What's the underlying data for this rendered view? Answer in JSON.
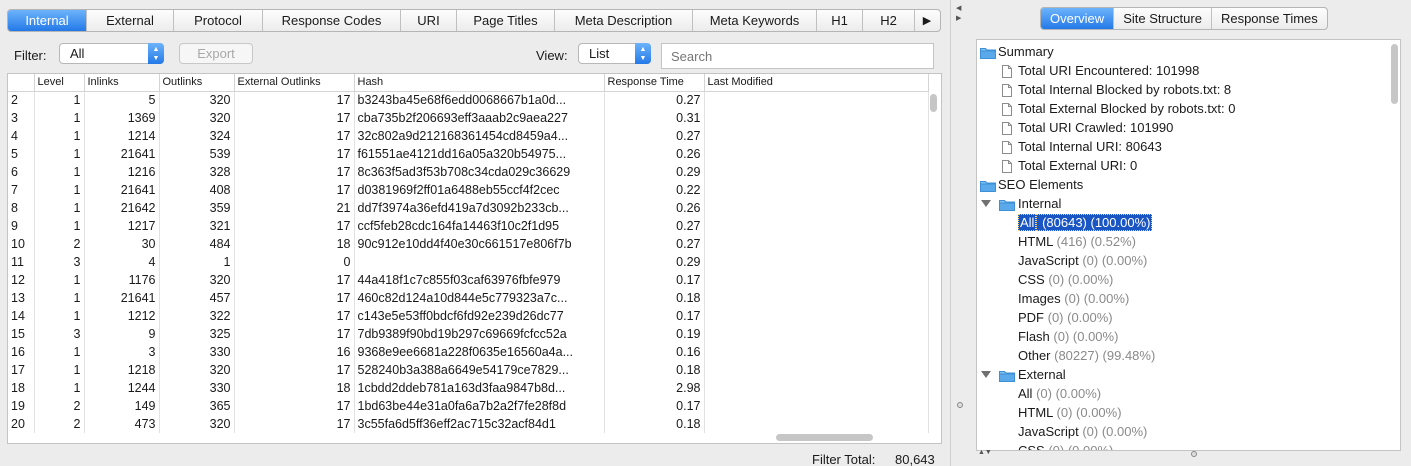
{
  "tabs": [
    "Internal",
    "External",
    "Protocol",
    "Response Codes",
    "URI",
    "Page Titles",
    "Meta Description",
    "Meta Keywords",
    "H1",
    "H2"
  ],
  "toolbar": {
    "filter_label": "Filter:",
    "filter_value": "All",
    "export_label": "Export",
    "view_label": "View:",
    "view_value": "List",
    "search_placeholder": "Search"
  },
  "table": {
    "columns": [
      "",
      "Level",
      "Inlinks",
      "Outlinks",
      "External Outlinks",
      "Hash",
      "Response Time",
      "Last Modified"
    ],
    "rows": [
      [
        "2",
        "1",
        "5",
        "320",
        "17",
        "b3243ba45e68f6edd0068667b1a0d...",
        "0.27",
        ""
      ],
      [
        "3",
        "1",
        "1369",
        "320",
        "17",
        "cba735b2f206693eff3aaab2c9aea227",
        "0.31",
        ""
      ],
      [
        "4",
        "1",
        "1214",
        "324",
        "17",
        "32c802a9d212168361454cd8459a4...",
        "0.27",
        ""
      ],
      [
        "5",
        "1",
        "21641",
        "539",
        "17",
        "f61551ae4121dd16a05a320b54975...",
        "0.26",
        ""
      ],
      [
        "6",
        "1",
        "1216",
        "328",
        "17",
        "8c363f5ad3f53b708c34cda029c36629",
        "0.29",
        ""
      ],
      [
        "7",
        "1",
        "21641",
        "408",
        "17",
        "d0381969f2ff01a6488eb55ccf4f2cec",
        "0.22",
        ""
      ],
      [
        "8",
        "1",
        "21642",
        "359",
        "21",
        "dd7f3974a36efd419a7d3092b233cb...",
        "0.26",
        ""
      ],
      [
        "9",
        "1",
        "1217",
        "321",
        "17",
        "ccf5feb28cdc164fa14463f10c2f1d95",
        "0.27",
        ""
      ],
      [
        "10",
        "2",
        "30",
        "484",
        "18",
        "90c912e10dd4f40e30c661517e806f7b",
        "0.27",
        ""
      ],
      [
        "11",
        "3",
        "4",
        "1",
        "0",
        "",
        "0.29",
        ""
      ],
      [
        "12",
        "1",
        "1176",
        "320",
        "17",
        "44a418f1c7c855f03caf63976fbfe979",
        "0.17",
        ""
      ],
      [
        "13",
        "1",
        "21641",
        "457",
        "17",
        "460c82d124a10d844e5c779323a7c...",
        "0.18",
        ""
      ],
      [
        "14",
        "1",
        "1212",
        "322",
        "17",
        "c143e5e53ff0bdcf6fd92e239d26dc77",
        "0.17",
        ""
      ],
      [
        "15",
        "3",
        "9",
        "325",
        "17",
        "7db9389f90bd19b297c69669fcfcc52a",
        "0.19",
        ""
      ],
      [
        "16",
        "1",
        "3",
        "330",
        "16",
        "9368e9ee6681a228f0635e16560a4a...",
        "0.16",
        ""
      ],
      [
        "17",
        "1",
        "1218",
        "320",
        "17",
        "528240b3a388a6649e54179ce7829...",
        "0.18",
        ""
      ],
      [
        "18",
        "1",
        "1244",
        "330",
        "18",
        "1cbdd2ddeb781a163d3faa9847b8d...",
        "2.98",
        ""
      ],
      [
        "19",
        "2",
        "149",
        "365",
        "17",
        "1bd63be44e31a0fa6a7b2a2f7fe28f8d",
        "0.17",
        ""
      ],
      [
        "20",
        "2",
        "473",
        "320",
        "17",
        "3c55fa6d5ff36eff2ac715c32acf84d1",
        "0.18",
        ""
      ]
    ]
  },
  "footer": {
    "label": "Filter Total:",
    "value": "80,643"
  },
  "right_tabs": [
    "Overview",
    "Site Structure",
    "Response Times"
  ],
  "tree": {
    "summary": "Summary",
    "summary_items": [
      "Total URI Encountered: 101998",
      "Total Internal Blocked by robots.txt: 8",
      "Total External Blocked by robots.txt: 0",
      "Total URI Crawled: 101990",
      "Total Internal URI: 80643",
      "Total External URI: 0"
    ],
    "seo": "SEO Elements",
    "internal": "Internal",
    "internal_items": [
      {
        "name": "All",
        "stats": "(80643) (100.00%)"
      },
      {
        "name": "HTML",
        "stats": "(416) (0.52%)"
      },
      {
        "name": "JavaScript",
        "stats": "(0) (0.00%)"
      },
      {
        "name": "CSS",
        "stats": "(0) (0.00%)"
      },
      {
        "name": "Images",
        "stats": "(0) (0.00%)"
      },
      {
        "name": "PDF",
        "stats": "(0) (0.00%)"
      },
      {
        "name": "Flash",
        "stats": "(0) (0.00%)"
      },
      {
        "name": "Other",
        "stats": "(80227) (99.48%)"
      }
    ],
    "external": "External",
    "external_items": [
      {
        "name": "All",
        "stats": "(0) (0.00%)"
      },
      {
        "name": "HTML",
        "stats": "(0) (0.00%)"
      },
      {
        "name": "JavaScript",
        "stats": "(0) (0.00%)"
      },
      {
        "name": "CSS",
        "stats": "(0) (0.00%)"
      }
    ]
  },
  "colors": {
    "accent": "#2479e8",
    "selection": "#1a55c4",
    "folder": "#5aa9ea"
  }
}
